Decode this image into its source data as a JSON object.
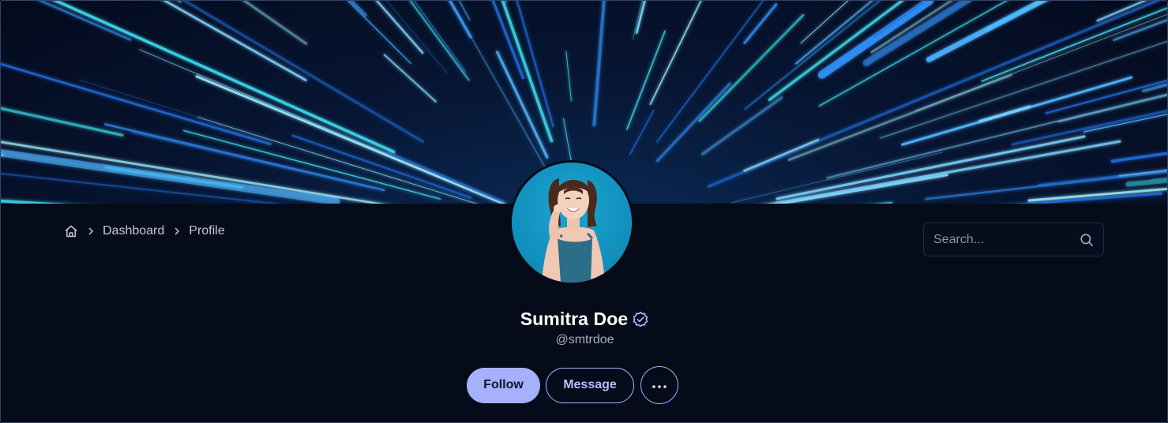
{
  "breadcrumb": {
    "home_icon": "home-icon",
    "items": [
      {
        "label": "Dashboard"
      },
      {
        "label": "Profile"
      }
    ]
  },
  "search": {
    "placeholder": "Search...",
    "value": "",
    "icon": "search-icon"
  },
  "profile": {
    "name": "Sumitra Doe",
    "handle": "@smtrdoe",
    "verified": true,
    "verified_icon": "verified-badge-icon"
  },
  "actions": {
    "follow_label": "Follow",
    "message_label": "Message",
    "more_label": "···"
  },
  "colors": {
    "background": "#050b18",
    "accent": "#a5b1fb",
    "cover_cyan": "#3fe0f2",
    "cover_blue": "#2f8cf0"
  }
}
